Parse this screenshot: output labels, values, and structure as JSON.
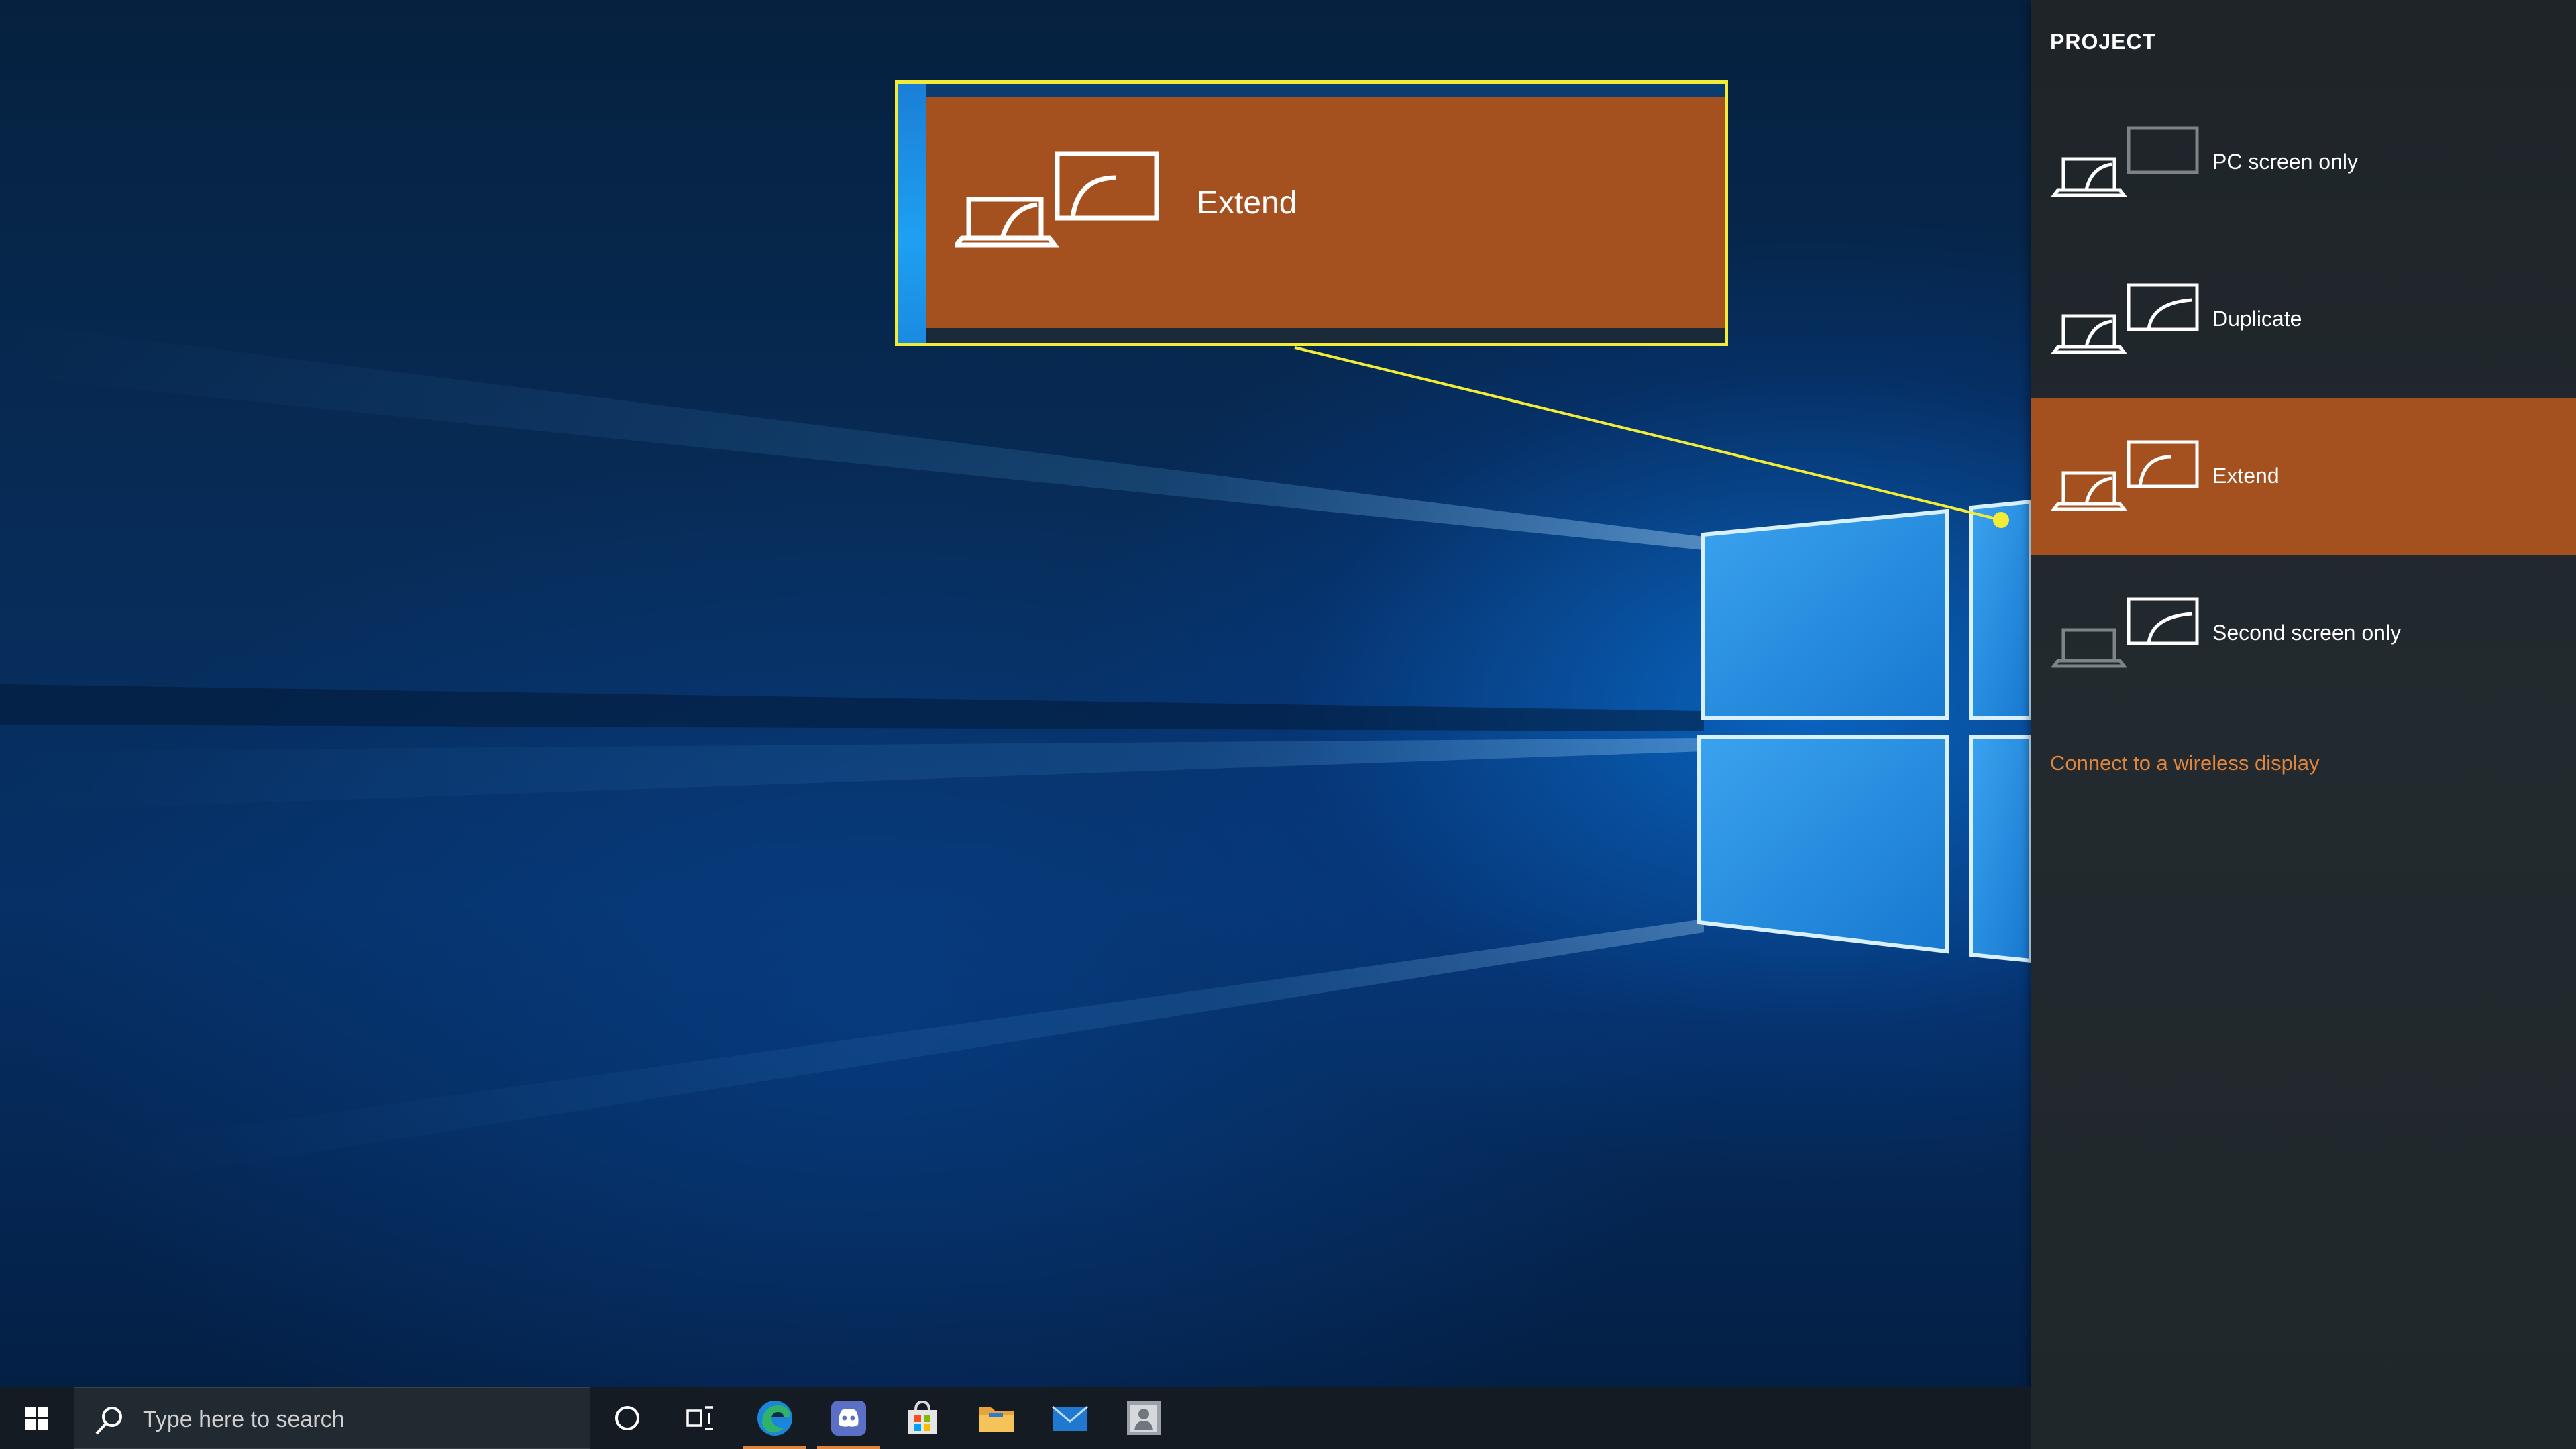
{
  "project_panel": {
    "title": "PROJECT",
    "options": [
      {
        "label": "PC screen only",
        "selected": false
      },
      {
        "label": "Duplicate",
        "selected": false
      },
      {
        "label": "Extend",
        "selected": true
      },
      {
        "label": "Second screen only",
        "selected": false
      }
    ],
    "wireless_link": "Connect to a wireless display"
  },
  "callout": {
    "label": "Extend",
    "icon": "extend-icon"
  },
  "taskbar": {
    "search_placeholder": "Type here to search",
    "apps": [
      {
        "name": "start-icon"
      },
      {
        "name": "cortana-icon"
      },
      {
        "name": "task-view-icon"
      },
      {
        "name": "edge-icon",
        "active": true
      },
      {
        "name": "discord-icon",
        "active": true
      },
      {
        "name": "store-icon"
      },
      {
        "name": "file-explorer-icon"
      },
      {
        "name": "mail-icon"
      },
      {
        "name": "app-icon"
      }
    ]
  },
  "colors": {
    "accent": "#a5501f",
    "link": "#e0853e",
    "highlight_border": "#f2ec38",
    "panel_bg": "#20272b",
    "taskbar_bg": "#141b22"
  }
}
